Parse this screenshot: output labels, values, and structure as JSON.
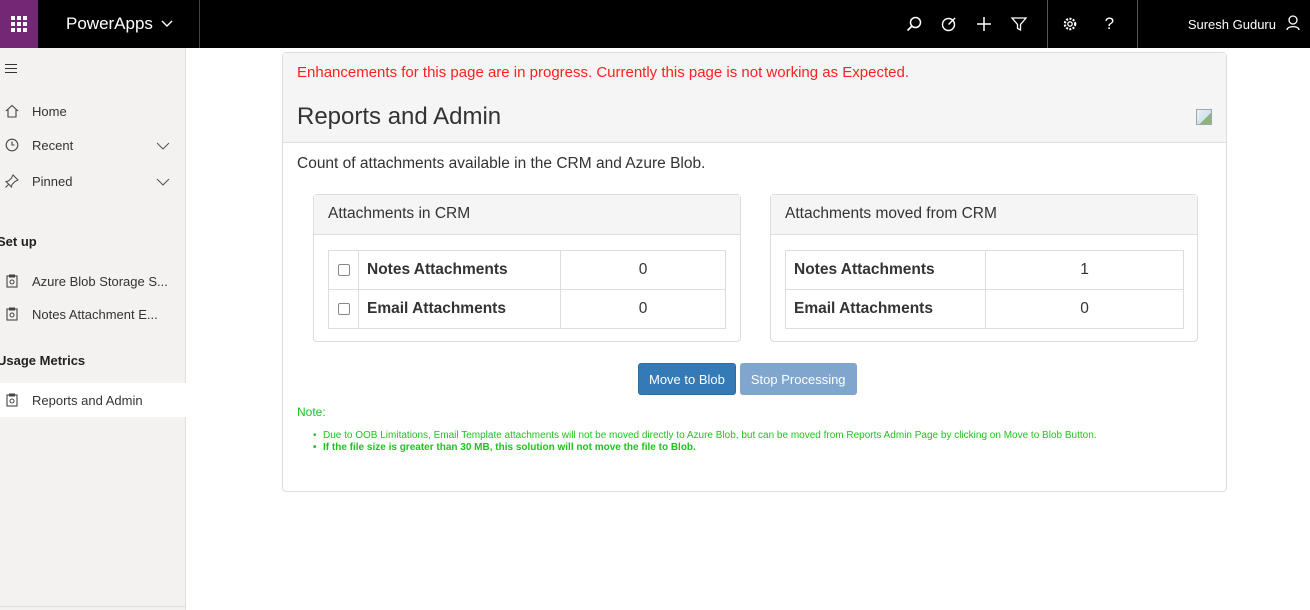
{
  "topbar": {
    "app_name": "PowerApps",
    "user_name": "Suresh Guduru",
    "icons": [
      "search-icon",
      "target-icon",
      "plus-icon",
      "filter-icon",
      "gear-icon",
      "help-icon",
      "person-icon"
    ],
    "waffle_color": "#742774"
  },
  "sidebar": {
    "items": [
      {
        "label": "Home",
        "icon": "home-icon"
      },
      {
        "label": "Recent",
        "icon": "clock-icon"
      },
      {
        "label": "Pinned",
        "icon": "pin-icon"
      }
    ],
    "sections": [
      {
        "title": "Set up",
        "items": [
          {
            "label": "Azure Blob Storage S..."
          },
          {
            "label": "Notes Attachment E..."
          }
        ]
      },
      {
        "title": "Usage Metrics",
        "items": [
          {
            "label": "Reports and Admin"
          }
        ]
      }
    ]
  },
  "panel": {
    "warning": "Enhancements for this page are in progress. Currently this page is not working as Expected.",
    "title": "Reports and Admin",
    "subtitle": "Count of attachments available in the CRM and Azure Blob.",
    "crm": {
      "title": "Attachments in CRM",
      "rows": [
        {
          "label": "Notes Attachments",
          "value": "0"
        },
        {
          "label": "Email Attachments",
          "value": "0"
        }
      ]
    },
    "moved": {
      "title": "Attachments moved from CRM",
      "rows": [
        {
          "label": "Notes Attachments",
          "value": "1"
        },
        {
          "label": "Email Attachments",
          "value": "0"
        }
      ]
    },
    "buttons": {
      "move": "Move to Blob",
      "stop": "Stop Processing"
    },
    "note_label": "Note:",
    "notes": [
      "Due to OOB Limitations, Email Template attachments will not be moved directly to Azure Blob, but can be moved from Reports Admin Page by clicking on Move to Blob Button.",
      "If the file size is greater than 30 MB, this solution will not move the file to Blob."
    ],
    "warning_color": "#ff1f1f",
    "note_color": "#22c122"
  }
}
